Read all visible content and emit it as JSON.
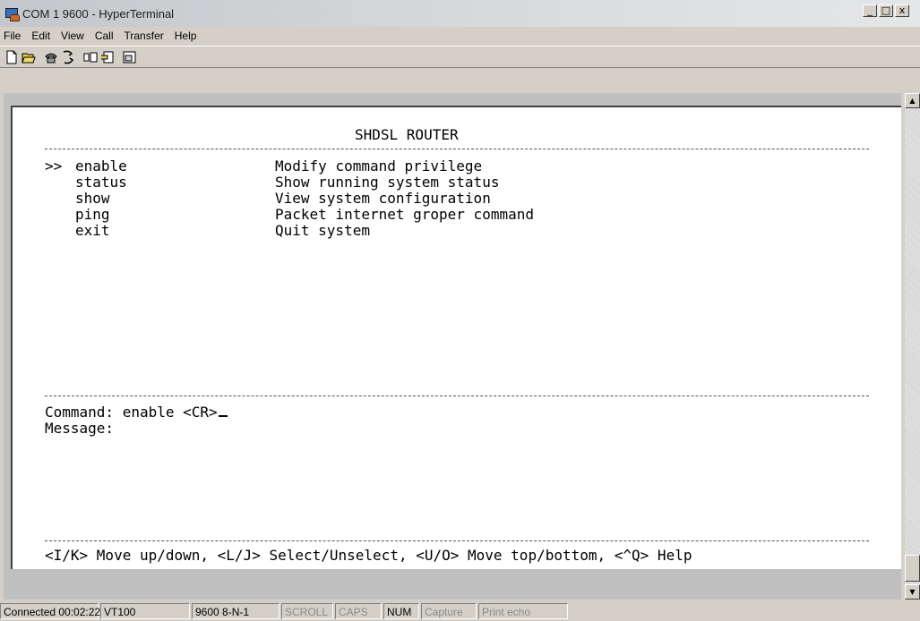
{
  "window": {
    "title": "COM 1 9600 - HyperTerminal",
    "controls": {
      "minimize": "_",
      "maximize": "□",
      "close": "x"
    }
  },
  "menu": {
    "items": [
      {
        "label": "File"
      },
      {
        "label": "Edit"
      },
      {
        "label": "View"
      },
      {
        "label": "Call"
      },
      {
        "label": "Transfer"
      },
      {
        "label": "Help"
      }
    ]
  },
  "toolbar": {
    "buttons": [
      "new-icon",
      "open-icon",
      "call-icon",
      "disconnect-icon",
      "send-icon",
      "receive-icon",
      "properties-icon"
    ]
  },
  "terminal": {
    "header": "SHDSL ROUTER",
    "menu": [
      {
        "marker": ">>",
        "command": "enable",
        "description": "Modify command privilege"
      },
      {
        "marker": "",
        "command": "status",
        "description": "Show running system status"
      },
      {
        "marker": "",
        "command": "show",
        "description": "View system configuration"
      },
      {
        "marker": "",
        "command": "ping",
        "description": "Packet internet groper command"
      },
      {
        "marker": "",
        "command": "exit",
        "description": "Quit system"
      }
    ],
    "command_line": "Command: enable <CR>",
    "message_line": "Message:",
    "help_line": "<I/K> Move up/down, <L/J> Select/Unselect, <U/O> Move top/bottom, <^Q> Help"
  },
  "statusbar": {
    "connected": "Connected 00:02:22",
    "emulation": "VT100",
    "settings": "9600 8-N-1",
    "scroll": "SCROLL",
    "caps": "CAPS",
    "num": "NUM",
    "capture": "Capture",
    "printecho": "Print echo"
  }
}
